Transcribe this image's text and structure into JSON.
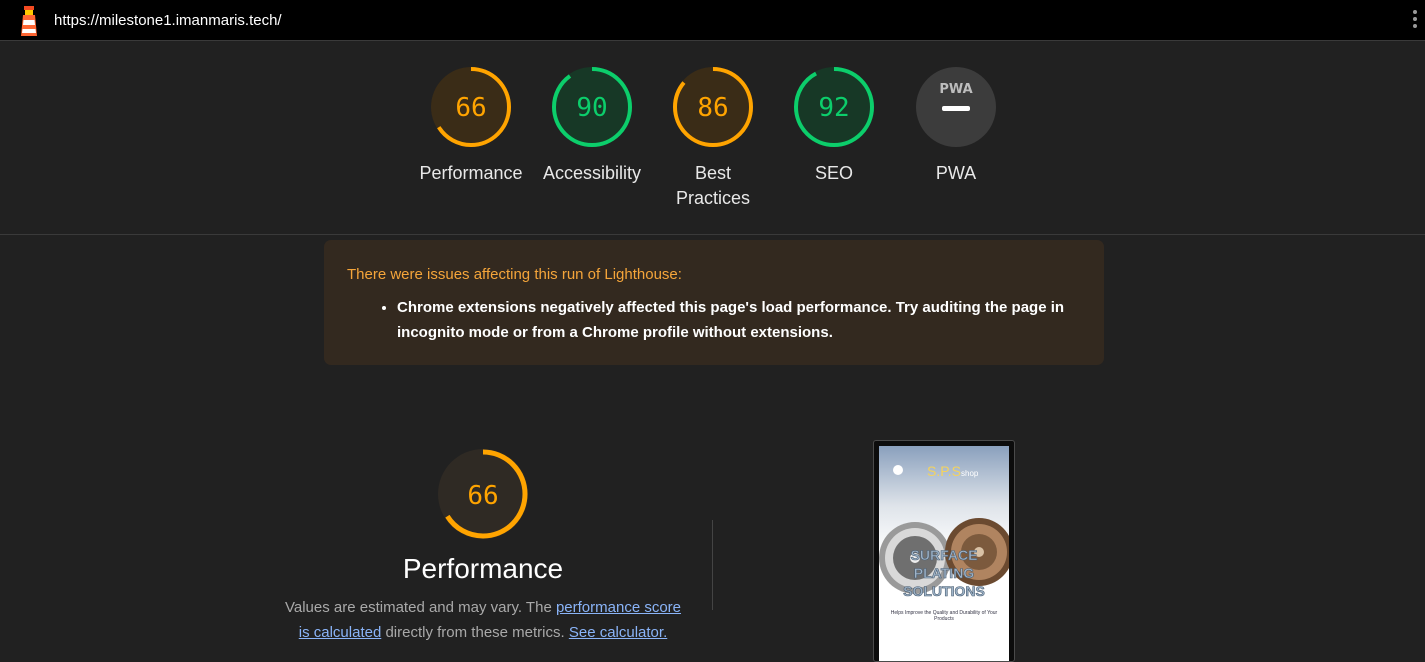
{
  "header": {
    "url": "https://milestone1.imanmaris.tech/"
  },
  "gauges": [
    {
      "score": "66",
      "label": "Performance",
      "value": 0.66,
      "color": "#ffa400",
      "bg": "#3a2c17"
    },
    {
      "score": "90",
      "label": "Accessibility",
      "value": 0.9,
      "color": "#0cce6b",
      "bg": "#173826"
    },
    {
      "score": "86",
      "label": "Best Practices",
      "value": 0.86,
      "color": "#ffa400",
      "bg": "#3a2c17"
    },
    {
      "score": "92",
      "label": "SEO",
      "value": 0.92,
      "color": "#0cce6b",
      "bg": "#173826"
    },
    {
      "score": "",
      "label": "PWA",
      "badge": "PWA",
      "color": "#9aa0a6",
      "bg": "#3c3c3c"
    }
  ],
  "warning": {
    "title": "There were issues affecting this run of Lighthouse:",
    "items": [
      "Chrome extensions negatively affected this page's load performance. Try auditing the page in incognito mode or from a Chrome profile without extensions."
    ]
  },
  "performance": {
    "score": "66",
    "value": 0.66,
    "title": "Performance",
    "desc_prefix": "Values are estimated and may vary. The ",
    "link_score": "performance score is calculated",
    "desc_mid": " directly from these metrics. ",
    "link_calc": "See calculator."
  },
  "screenshot": {
    "brand": "S.P.S",
    "brand_suffix": "shop",
    "headline_1": "SURFACE",
    "headline_2": "PLATING",
    "headline_3": "SOLUTIONS",
    "tagline": "Helps Improve the Quality and Durability of Your Products"
  }
}
